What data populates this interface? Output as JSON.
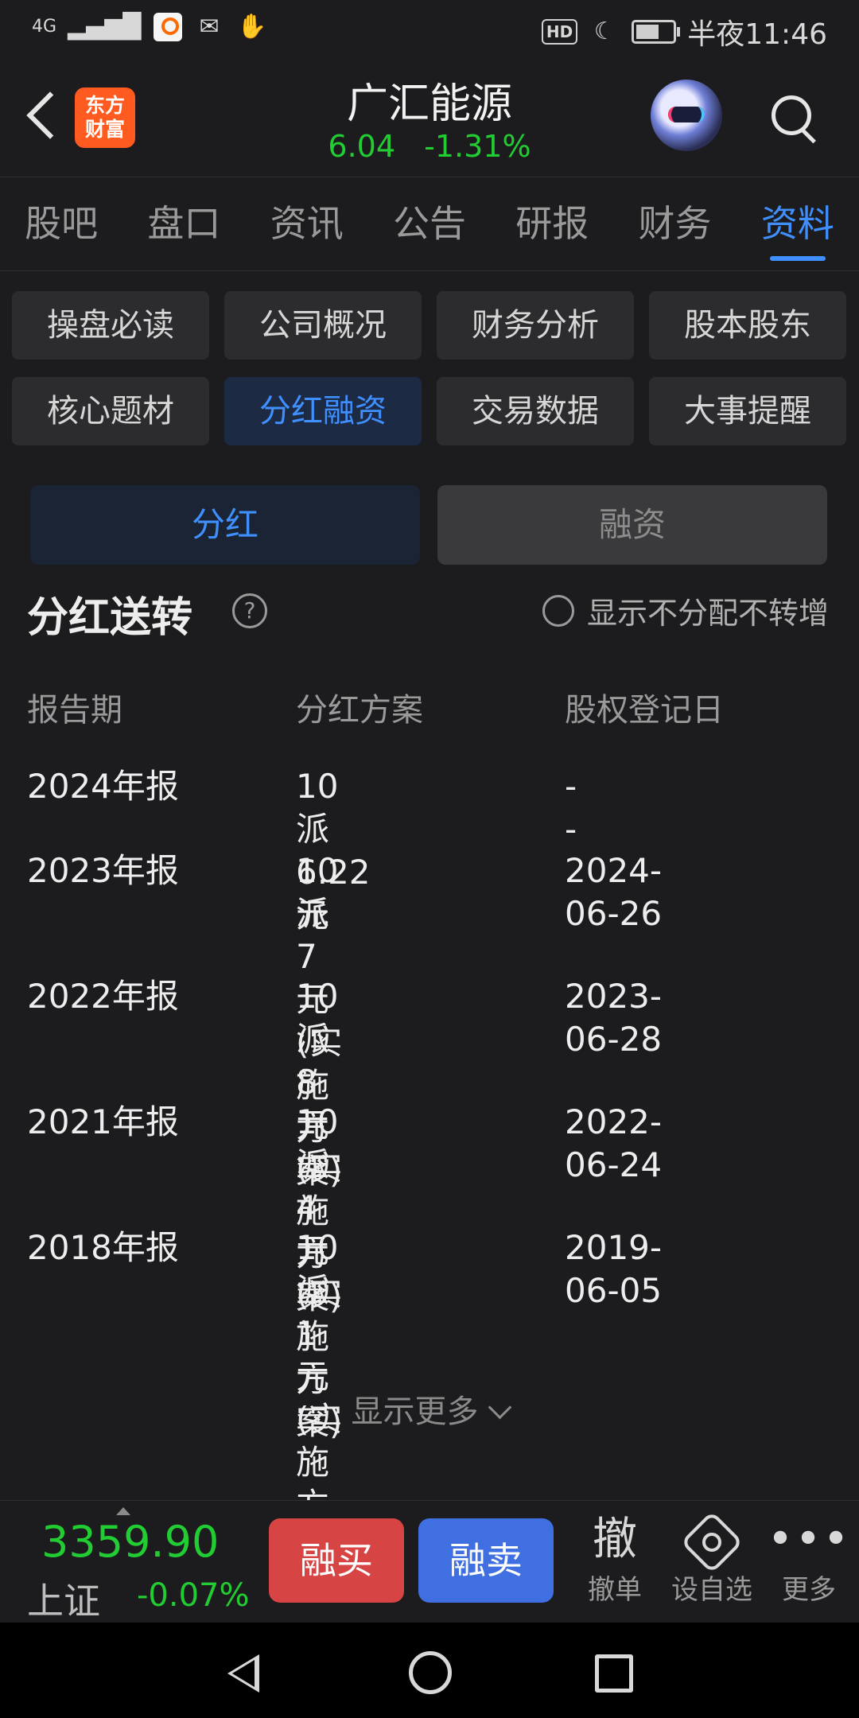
{
  "status": {
    "network": "4G",
    "time": "半夜11:46",
    "hd": "HD"
  },
  "header": {
    "logo_text": "东方财富",
    "stock_name": "广汇能源",
    "price": "6.04",
    "change_pct": "-1.31%",
    "quote_color": "#22cc33"
  },
  "tabs": [
    {
      "label": "股吧"
    },
    {
      "label": "盘口"
    },
    {
      "label": "资讯"
    },
    {
      "label": "公告"
    },
    {
      "label": "研报"
    },
    {
      "label": "财务"
    },
    {
      "label": "资料",
      "active": true
    }
  ],
  "sub_buttons": [
    {
      "label": "操盘必读"
    },
    {
      "label": "公司概况"
    },
    {
      "label": "财务分析"
    },
    {
      "label": "股本股东"
    },
    {
      "label": "核心题材"
    },
    {
      "label": "分红融资",
      "active": true
    },
    {
      "label": "交易数据"
    },
    {
      "label": "大事提醒"
    }
  ],
  "segment": {
    "active": "分红",
    "inactive": "融资"
  },
  "section": {
    "title": "分红送转",
    "help": "?",
    "toggle_label": "显示不分配不转增"
  },
  "table": {
    "headers": [
      "报告期",
      "分红方案",
      "股权登记日"
    ],
    "rows": [
      {
        "period": "2024年报",
        "plan": "10派6.22元",
        "note": "",
        "date": "--"
      },
      {
        "period": "2023年报",
        "plan": "10派7元",
        "note": "(实施方案)",
        "date": "2024-06-26"
      },
      {
        "period": "2022年报",
        "plan": "10派8元",
        "note": "(实施方案)",
        "date": "2023-06-28"
      },
      {
        "period": "2021年报",
        "plan": "10派4元",
        "note": "(实施方案)",
        "date": "2022-06-24"
      },
      {
        "period": "2018年报",
        "plan": "10派1元",
        "note": "(实施方案)",
        "date": "2019-06-05"
      }
    ]
  },
  "show_more": "显示更多",
  "bottom": {
    "index_value": "3359.90",
    "index_name": "上证",
    "index_change": "-0.07%",
    "buy_label": "融买",
    "sell_label": "融卖",
    "cancel_icon": "撤",
    "cancel_label": "撤单",
    "watch_label": "设自选",
    "more_icon": "•••",
    "more_label": "更多"
  }
}
